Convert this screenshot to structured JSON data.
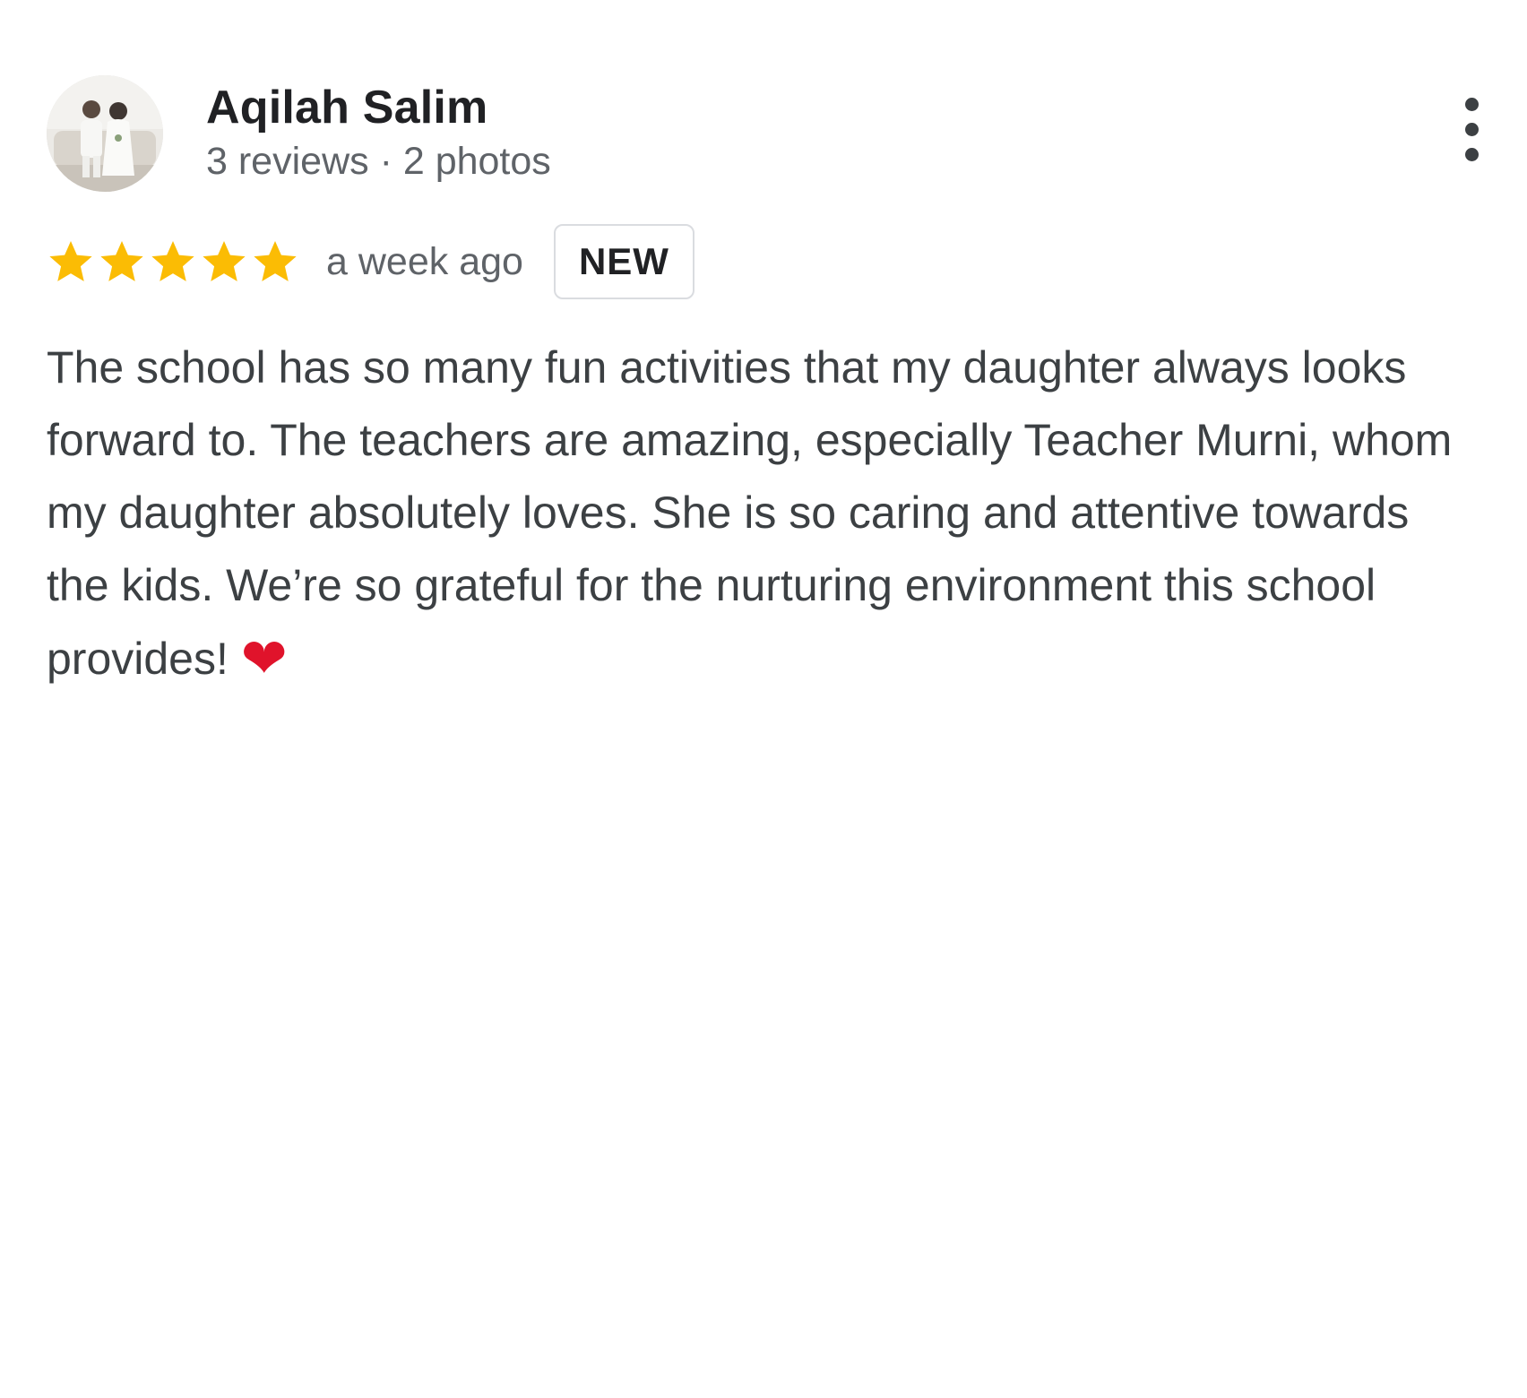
{
  "review": {
    "author": {
      "name": "Aqilah Salim",
      "meta": "3 reviews · 2 photos",
      "avatar": "profile-photo"
    },
    "menu_icon": "more-vertical-icon",
    "rating": {
      "stars": 5,
      "max_stars": 5,
      "star_color": "#fbbc04"
    },
    "date": "a week ago",
    "badge": "NEW",
    "text": "The school has so many fun activities that my daughter always looks forward to. The teachers are amazing, especially Teacher Murni, whom my daughter absolutely loves. She is so caring and attentive towards the kids. We’re so grateful for the nurturing environment this school provides!",
    "emoji": "❤",
    "emoji_name": "red-heart"
  }
}
